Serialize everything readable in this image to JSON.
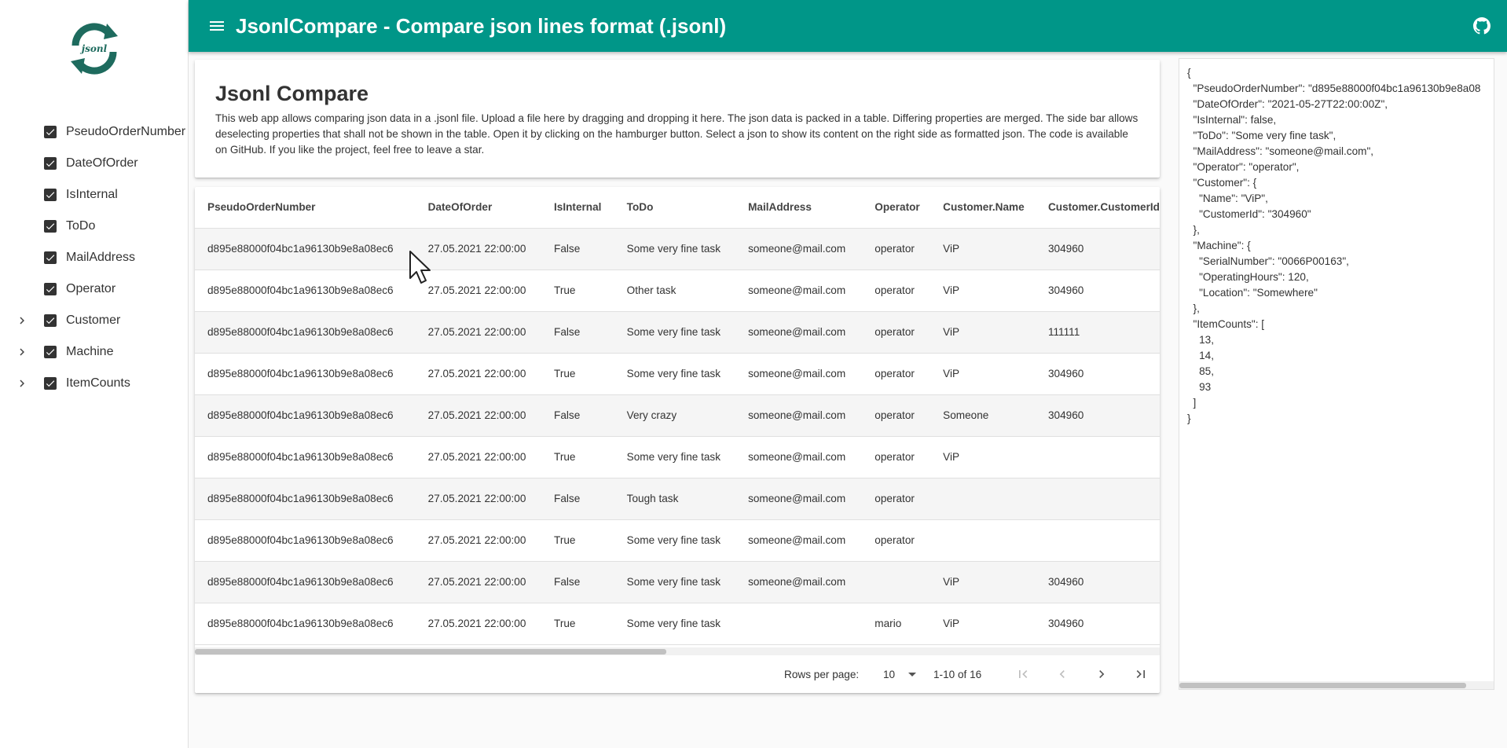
{
  "app": {
    "title": "JsonlCompare - Compare json lines format (.jsonl)",
    "logo_text": "jsonl",
    "accent": "#009688"
  },
  "sidebar": {
    "items": [
      {
        "label": "PseudoOrderNumber",
        "checked": true,
        "expandable": false
      },
      {
        "label": "DateOfOrder",
        "checked": true,
        "expandable": false
      },
      {
        "label": "IsInternal",
        "checked": true,
        "expandable": false
      },
      {
        "label": "ToDo",
        "checked": true,
        "expandable": false
      },
      {
        "label": "MailAddress",
        "checked": true,
        "expandable": false
      },
      {
        "label": "Operator",
        "checked": true,
        "expandable": false
      },
      {
        "label": "Customer",
        "checked": true,
        "expandable": true
      },
      {
        "label": "Machine",
        "checked": true,
        "expandable": true
      },
      {
        "label": "ItemCounts",
        "checked": true,
        "expandable": true
      }
    ]
  },
  "intro": {
    "heading": "Jsonl Compare",
    "text": "This web app allows comparing json data in a .jsonl file. Upload a file here by dragging and dropping it here. The json data is packed in a table. Differing properties are merged. The side bar allows deselecting properties that shall not be shown in the table. Open it by clicking on the hamburger button. Select a json to show its content on the right side as formatted json. The code is available on GitHub. If you like the project, feel free to leave a star."
  },
  "table": {
    "columns": [
      "PseudoOrderNumber",
      "DateOfOrder",
      "IsInternal",
      "ToDo",
      "MailAddress",
      "Operator",
      "Customer.Name",
      "Customer.CustomerId"
    ],
    "rows": [
      [
        "d895e88000f04bc1a96130b9e8a08ec6",
        "27.05.2021 22:00:00",
        "False",
        "Some very fine task",
        "someone@mail.com",
        "operator",
        "ViP",
        "304960"
      ],
      [
        "d895e88000f04bc1a96130b9e8a08ec6",
        "27.05.2021 22:00:00",
        "True",
        "Other task",
        "someone@mail.com",
        "operator",
        "ViP",
        "304960"
      ],
      [
        "d895e88000f04bc1a96130b9e8a08ec6",
        "27.05.2021 22:00:00",
        "False",
        "Some very fine task",
        "someone@mail.com",
        "operator",
        "ViP",
        "111111"
      ],
      [
        "d895e88000f04bc1a96130b9e8a08ec6",
        "27.05.2021 22:00:00",
        "True",
        "Some very fine task",
        "someone@mail.com",
        "operator",
        "ViP",
        "304960"
      ],
      [
        "d895e88000f04bc1a96130b9e8a08ec6",
        "27.05.2021 22:00:00",
        "False",
        "Very crazy",
        "someone@mail.com",
        "operator",
        "Someone",
        "304960"
      ],
      [
        "d895e88000f04bc1a96130b9e8a08ec6",
        "27.05.2021 22:00:00",
        "True",
        "Some very fine task",
        "someone@mail.com",
        "operator",
        "ViP",
        ""
      ],
      [
        "d895e88000f04bc1a96130b9e8a08ec6",
        "27.05.2021 22:00:00",
        "False",
        "Tough task",
        "someone@mail.com",
        "operator",
        "",
        ""
      ],
      [
        "d895e88000f04bc1a96130b9e8a08ec6",
        "27.05.2021 22:00:00",
        "True",
        "Some very fine task",
        "someone@mail.com",
        "operator",
        "",
        ""
      ],
      [
        "d895e88000f04bc1a96130b9e8a08ec6",
        "27.05.2021 22:00:00",
        "False",
        "Some very fine task",
        "someone@mail.com",
        "",
        "ViP",
        "304960"
      ],
      [
        "d895e88000f04bc1a96130b9e8a08ec6",
        "27.05.2021 22:00:00",
        "True",
        "Some very fine task",
        "",
        "mario",
        "ViP",
        "304960"
      ]
    ]
  },
  "pagination": {
    "rows_per_page_label": "Rows per page:",
    "rows_per_page_value": "10",
    "range": "1-10 of 16"
  },
  "json_view": {
    "lines": [
      "{",
      "  \"PseudoOrderNumber\": \"d895e88000f04bc1a96130b9e8a08",
      "  \"DateOfOrder\": \"2021-05-27T22:00:00Z\",",
      "  \"IsInternal\": false,",
      "  \"ToDo\": \"Some very fine task\",",
      "  \"MailAddress\": \"someone@mail.com\",",
      "  \"Operator\": \"operator\",",
      "  \"Customer\": {",
      "    \"Name\": \"ViP\",",
      "    \"CustomerId\": \"304960\"",
      "  },",
      "  \"Machine\": {",
      "    \"SerialNumber\": \"0066P00163\",",
      "    \"OperatingHours\": 120,",
      "    \"Location\": \"Somewhere\"",
      "  },",
      "  \"ItemCounts\": [",
      "    13,",
      "    14,",
      "    85,",
      "    93",
      "  ]",
      "}"
    ]
  }
}
